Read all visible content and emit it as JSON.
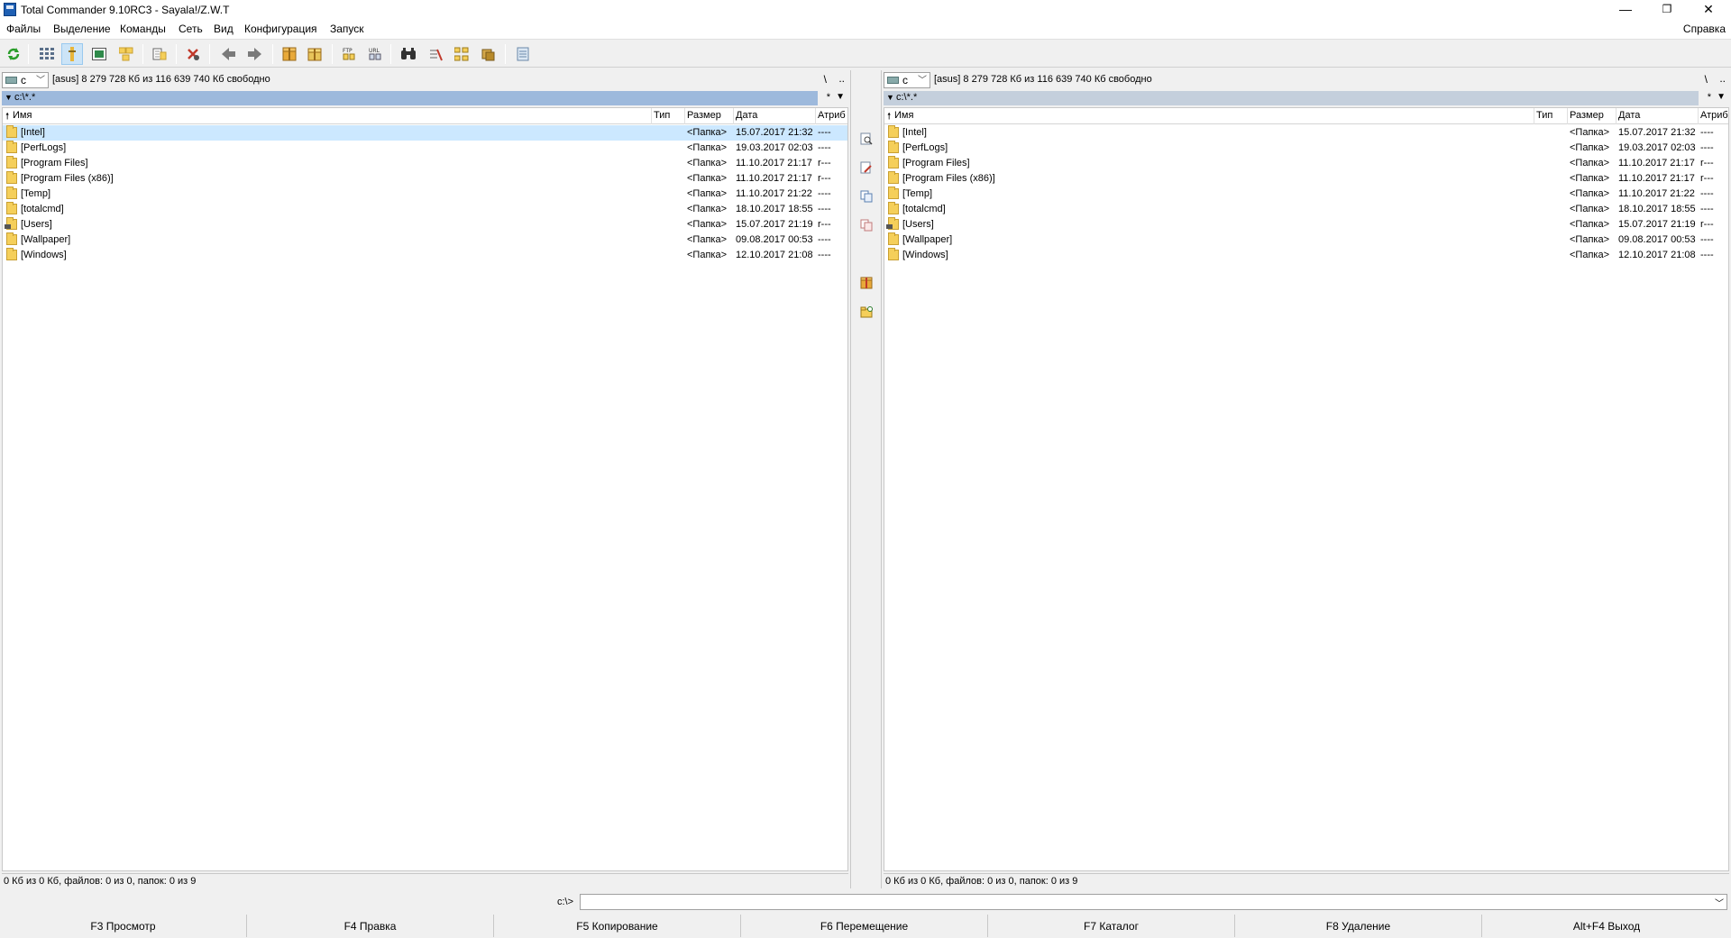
{
  "window": {
    "title": "Total Commander 9.10RC3 - Sayala!/Z.W.T",
    "minimize": "—",
    "maximize": "❐",
    "close": "✕"
  },
  "menu": {
    "items": [
      "Файлы",
      "Выделение",
      "Команды",
      "Сеть",
      "Вид",
      "Конфигурация",
      "Запуск"
    ],
    "help": "Справка"
  },
  "toolbar": {
    "icons": [
      "refresh-icon",
      "brief-view-icon",
      "detailed-view-icon",
      "thumbnails-icon",
      "tree-view-icon",
      "sync-dirs-icon",
      "unpack-icon",
      "back-icon",
      "forward-icon",
      "pack-icon",
      "unpack-files-icon",
      "ftp-connect-icon",
      "url-connect-icon",
      "search-icon",
      "multi-rename-icon",
      "compare-dirs-icon",
      "tree-icon",
      "notepad-icon"
    ]
  },
  "left_panel": {
    "drive_letter": "c",
    "drive_info": "[asus]  8 279 728 Кб из 116 639 740 Кб свободно",
    "root_btn": "\\",
    "up_btn": "..",
    "path": "c:\\*.*",
    "path_star": "*",
    "columns": {
      "name": "Имя",
      "type": "Тип",
      "size": "Размер",
      "date": "Дата",
      "attr": "Атриб"
    },
    "rows": [
      {
        "name": "[Intel]",
        "size": "<Папка>",
        "date": "15.07.2017 21:32",
        "attr": "----"
      },
      {
        "name": "[PerfLogs]",
        "size": "<Папка>",
        "date": "19.03.2017 02:03",
        "attr": "----"
      },
      {
        "name": "[Program Files]",
        "size": "<Папка>",
        "date": "11.10.2017 21:17",
        "attr": "r---"
      },
      {
        "name": "[Program Files (x86)]",
        "size": "<Папка>",
        "date": "11.10.2017 21:17",
        "attr": "r---"
      },
      {
        "name": "[Temp]",
        "size": "<Папка>",
        "date": "11.10.2017 21:22",
        "attr": "----"
      },
      {
        "name": "[totalcmd]",
        "size": "<Папка>",
        "date": "18.10.2017 18:55",
        "attr": "----"
      },
      {
        "name": "[Users]",
        "size": "<Папка>",
        "date": "15.07.2017 21:19",
        "attr": "r---"
      },
      {
        "name": "[Wallpaper]",
        "size": "<Папка>",
        "date": "09.08.2017 00:53",
        "attr": "----"
      },
      {
        "name": "[Windows]",
        "size": "<Папка>",
        "date": "12.10.2017 21:08",
        "attr": "----"
      }
    ],
    "status": "0 Кб из 0 Кб, файлов: 0 из 0, папок: 0 из 9"
  },
  "right_panel": {
    "drive_letter": "c",
    "drive_info": "[asus]  8 279 728 Кб из 116 639 740 Кб свободно",
    "root_btn": "\\",
    "up_btn": "..",
    "path": "c:\\*.*",
    "path_star": "*",
    "columns": {
      "name": "Имя",
      "type": "Тип",
      "size": "Размер",
      "date": "Дата",
      "attr": "Атриб"
    },
    "rows": [
      {
        "name": "[Intel]",
        "size": "<Папка>",
        "date": "15.07.2017 21:32",
        "attr": "----"
      },
      {
        "name": "[PerfLogs]",
        "size": "<Папка>",
        "date": "19.03.2017 02:03",
        "attr": "----"
      },
      {
        "name": "[Program Files]",
        "size": "<Папка>",
        "date": "11.10.2017 21:17",
        "attr": "r---"
      },
      {
        "name": "[Program Files (x86)]",
        "size": "<Папка>",
        "date": "11.10.2017 21:17",
        "attr": "r---"
      },
      {
        "name": "[Temp]",
        "size": "<Папка>",
        "date": "11.10.2017 21:22",
        "attr": "----"
      },
      {
        "name": "[totalcmd]",
        "size": "<Папка>",
        "date": "18.10.2017 18:55",
        "attr": "----"
      },
      {
        "name": "[Users]",
        "size": "<Папка>",
        "date": "15.07.2017 21:19",
        "attr": "r---"
      },
      {
        "name": "[Wallpaper]",
        "size": "<Папка>",
        "date": "09.08.2017 00:53",
        "attr": "----"
      },
      {
        "name": "[Windows]",
        "size": "<Папка>",
        "date": "12.10.2017 21:08",
        "attr": "----"
      }
    ],
    "status": "0 Кб из 0 Кб, файлов: 0 из 0, папок: 0 из 9"
  },
  "command_line": {
    "label": "c:\\>",
    "value": ""
  },
  "fkeys": [
    "F3 Просмотр",
    "F4 Правка",
    "F5 Копирование",
    "F6 Перемещение",
    "F7 Каталог",
    "F8 Удаление",
    "Alt+F4 Выход"
  ],
  "colors": {
    "left_path_bar": "#9db9dc",
    "right_path_bar": "#c4cfdc",
    "selection": "#cce8ff",
    "folder": "#f5cf5a"
  }
}
